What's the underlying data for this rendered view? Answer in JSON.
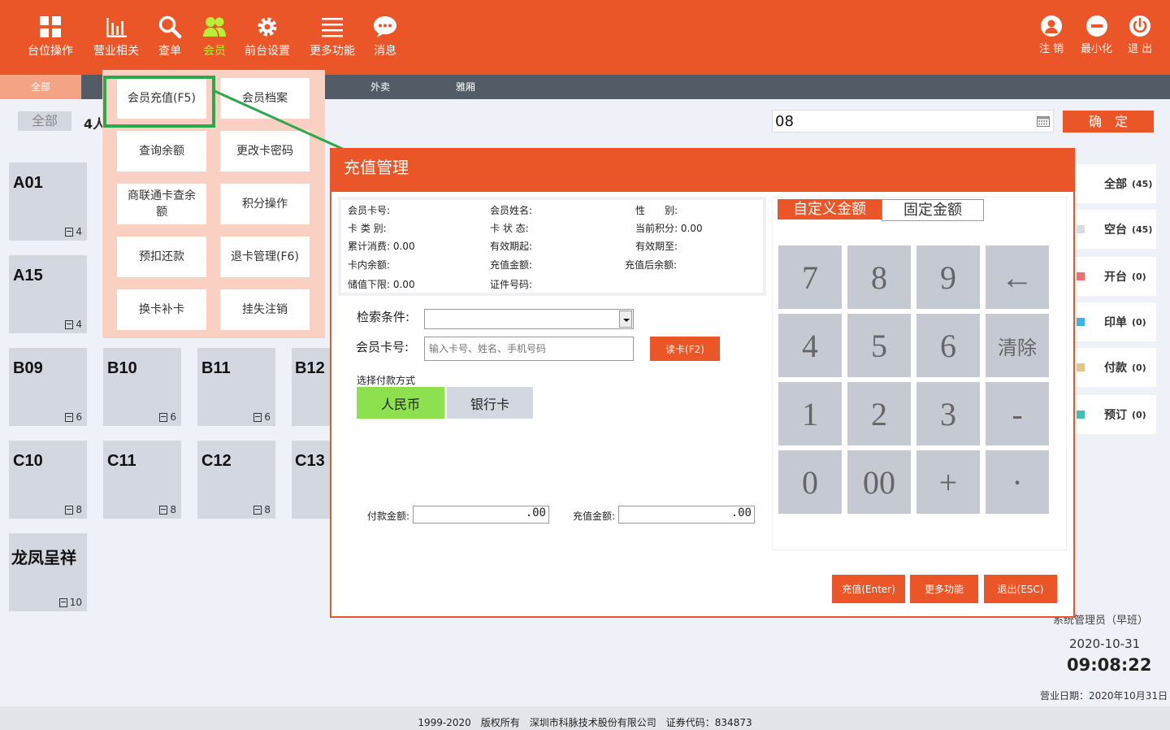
{
  "nav": [
    {
      "label": "台位操作",
      "icon": "grid-icon"
    },
    {
      "label": "营业相关",
      "icon": "bar-chart-icon"
    },
    {
      "label": "查单",
      "icon": "search-icon"
    },
    {
      "label": "会员",
      "icon": "members-icon"
    },
    {
      "label": "前台设置",
      "icon": "gear-icon"
    },
    {
      "label": "更多功能",
      "icon": "list-icon"
    },
    {
      "label": "消息",
      "icon": "chat-icon"
    }
  ],
  "right_nav": [
    {
      "label": "注 销",
      "icon": "user-icon"
    },
    {
      "label": "最小化",
      "icon": "minus-icon"
    },
    {
      "label": "退 出",
      "icon": "power-icon"
    }
  ],
  "subtabs": [
    "全部",
    "外卖",
    "雅厢"
  ],
  "filter": {
    "label": "全部",
    "count": "4人"
  },
  "search_value": "08",
  "confirm_label": "确　定",
  "tables": [
    {
      "name": "A01",
      "seats": "4"
    },
    {
      "name": "A15",
      "seats": "4"
    },
    {
      "name": "B09",
      "seats": "6"
    },
    {
      "name": "B10",
      "seats": "6"
    },
    {
      "name": "B11",
      "seats": "6"
    },
    {
      "name": "B12",
      "seats": ""
    },
    {
      "name": "C10",
      "seats": "8"
    },
    {
      "name": "C11",
      "seats": "8"
    },
    {
      "name": "C12",
      "seats": "8"
    },
    {
      "name": "C13",
      "seats": ""
    },
    {
      "name": "龙凤呈祥",
      "seats": "10"
    }
  ],
  "member_menu": [
    "会员充值(F5)",
    "会员档案",
    "查询余额",
    "更改卡密码",
    "商联通卡查余额",
    "积分操作",
    "预扣还款",
    "退卡管理(F6)",
    "换卡补卡",
    "挂失注销"
  ],
  "status": [
    {
      "label": "全部",
      "count": "(45)",
      "color": "#ffffff"
    },
    {
      "label": "空台",
      "count": "(45)",
      "color": "#d8dce6"
    },
    {
      "label": "开台",
      "count": "(0)",
      "color": "#f26d6d"
    },
    {
      "label": "印单",
      "count": "(0)",
      "color": "#3fb3e0"
    },
    {
      "label": "付款",
      "count": "(0)",
      "color": "#e3c58e"
    },
    {
      "label": "预订",
      "count": "(0)",
      "color": "#3fc1b3"
    }
  ],
  "footer_info": {
    "operator": "系统管理员（早班）",
    "date": "2020-10-31",
    "time": "09:08:22",
    "business_date": "营业日期：2020年10月31日"
  },
  "copyright": "1999-2020　版权所有　深圳市科脉技术股份有限公司　证券代码：834873",
  "dialog": {
    "title": "充值管理",
    "info": {
      "card_no": "会员卡号:",
      "name": "会员姓名:",
      "gender": "性　　别:",
      "card_type": "卡 类 别:",
      "card_state": "卡 状 态:",
      "points": "当前积分: 0.00",
      "total_spend": "累计消费: 0.00",
      "valid_from": "有效期起:",
      "valid_to": "有效期至:",
      "balance": "卡内余额:",
      "recharge_amount": "充值金额:",
      "after_balance": "充值后余额:",
      "min_stored": "储值下限: 0.00",
      "id_no": "证件号码:"
    },
    "search_label": "检索条件:",
    "card_label": "会员卡号:",
    "card_placeholder": "输入卡号、姓名、手机号码",
    "read_card": "读卡(F2)",
    "pay_method_label": "选择付款方式",
    "pay_methods": [
      "人民币",
      "银行卡"
    ],
    "pay_amount_label": "付款金额:",
    "pay_amount": ".00",
    "recharge_label": "充值金额:",
    "recharge_value": ".00",
    "tabs": [
      "自定义金额",
      "固定金额"
    ],
    "keys": [
      "7",
      "8",
      "9",
      "←",
      "4",
      "5",
      "6",
      "清除",
      "1",
      "2",
      "3",
      "-",
      "0",
      "00",
      "+",
      "·"
    ],
    "buttons": [
      "充值(Enter)",
      "更多功能",
      "退出(ESC)"
    ]
  }
}
